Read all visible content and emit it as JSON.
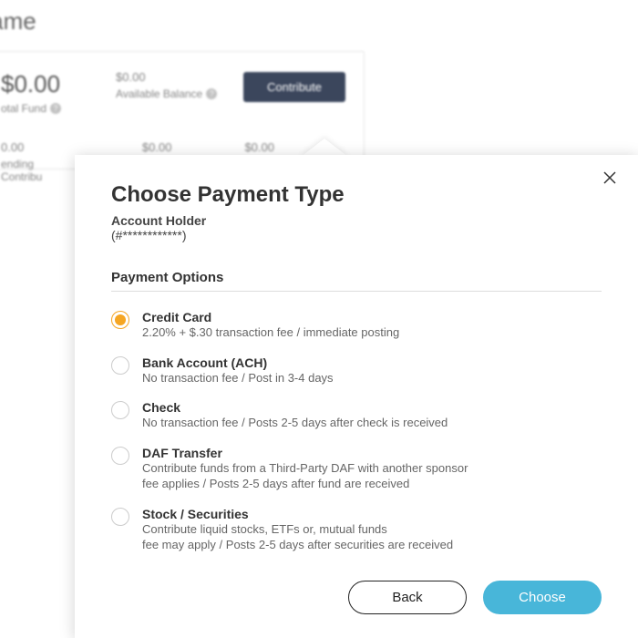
{
  "background": {
    "page_title": "er Name",
    "total_fund_amount": "$0.00",
    "total_fund_label": "otal Fund",
    "available_amount": "$0.00",
    "available_label": "Available Balance",
    "contribute_label": "Contribute",
    "row2_a": "0.00",
    "row2_a_label": "ending Contribu",
    "row2_b": "$0.00",
    "row2_c": "$0.00"
  },
  "modal": {
    "title": "Choose Payment Type",
    "account_holder_label": "Account Holder",
    "account_mask": "(#************)",
    "section_head": "Payment Options",
    "options": [
      {
        "title": "Credit Card",
        "desc": "2.20% + $.30 transaction fee / immediate posting",
        "selected": true
      },
      {
        "title": "Bank Account (ACH)",
        "desc": "No transaction fee / Post in 3-4 days",
        "selected": false
      },
      {
        "title": "Check",
        "desc": "No transaction fee / Posts 2-5 days after check is received",
        "selected": false
      },
      {
        "title": "DAF Transfer",
        "desc": "Contribute funds from a Third-Party DAF with another sponsor\nfee applies / Posts 2-5 days after fund are received",
        "selected": false
      },
      {
        "title": "Stock / Securities",
        "desc": "Contribute liquid stocks, ETFs or, mutual funds\nfee may apply / Posts 2-5 days after securities are received",
        "selected": false
      }
    ],
    "back_label": "Back",
    "choose_label": "Choose"
  }
}
